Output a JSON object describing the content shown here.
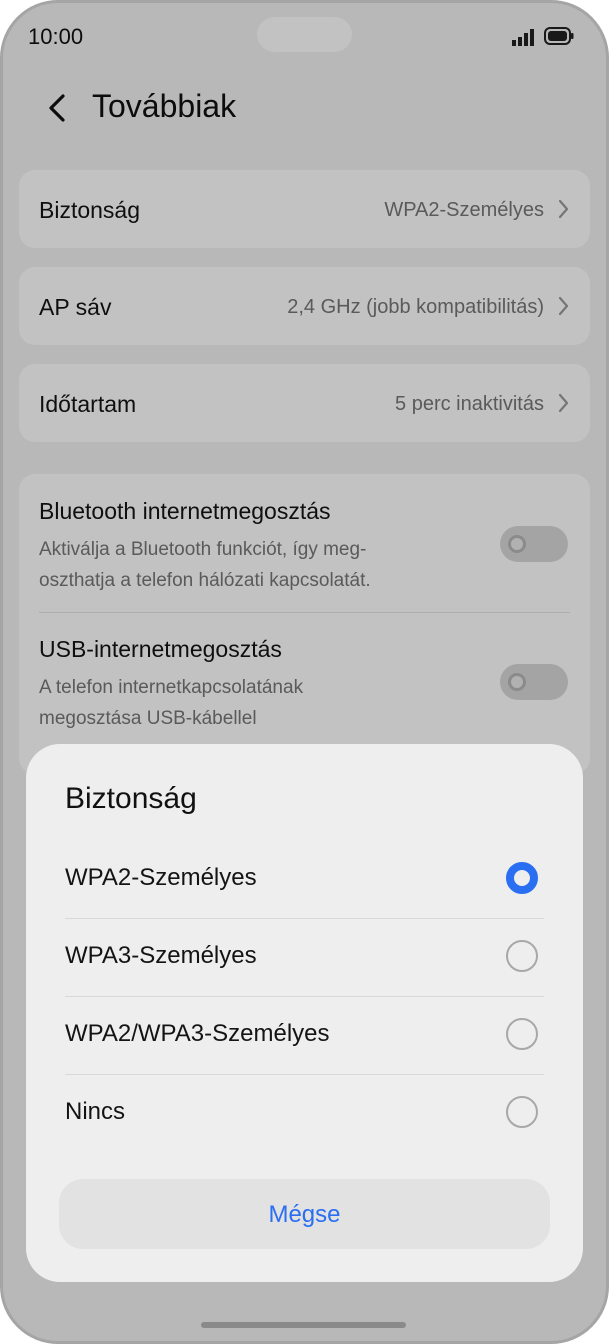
{
  "status_bar": {
    "time": "10:00",
    "icons": [
      "signal-icon",
      "battery-icon"
    ]
  },
  "header": {
    "title": "Továbbiak",
    "back_icon": "chevron-left-icon"
  },
  "settings": {
    "security": {
      "label": "Biztonság",
      "value": "WPA2-Személyes"
    },
    "ap_band": {
      "label": "AP sáv",
      "value": "2,4 GHz (jobb kompatibilitás)"
    },
    "timeout": {
      "label": "Időtartam",
      "value": "5 perc inaktivitás"
    },
    "bluetooth": {
      "label": "Bluetooth internetmegosztás",
      "description_line1": "Aktiválja a Bluetooth funkciót, így meg-",
      "description_line2": "oszthatja a telefon hálózati kapcsolatát.",
      "enabled": false
    },
    "usb": {
      "label": "USB-internetmegosztás",
      "description_line1": "A telefon internetkapcsolatának",
      "description_line2": "megosztása USB-kábellel",
      "enabled": false
    }
  },
  "sheet": {
    "title": "Biztonság",
    "options": [
      {
        "label": "WPA2-Személyes",
        "selected": true
      },
      {
        "label": "WPA3-Személyes",
        "selected": false
      },
      {
        "label": "WPA2/WPA3-Személyes",
        "selected": false
      },
      {
        "label": "Nincs",
        "selected": false
      }
    ],
    "cancel_label": "Mégse"
  },
  "colors": {
    "accent": "#2a6ef2",
    "background": "#f2f2f2",
    "card": "#ffffff",
    "sheet": "#eeeeee"
  }
}
